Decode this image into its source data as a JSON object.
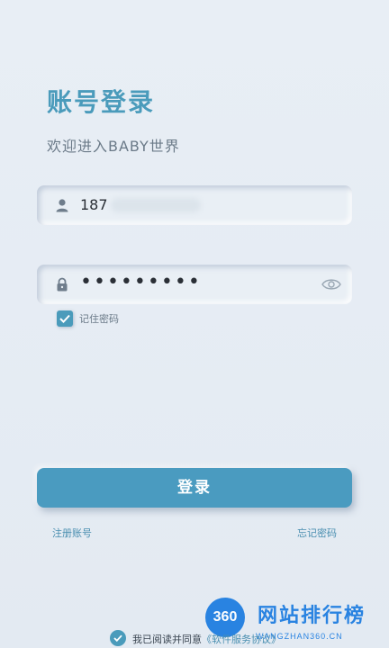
{
  "header": {
    "title": "账号登录",
    "subtitle": "欢迎进入BABY世界"
  },
  "username_field": {
    "icon": "user-icon",
    "value": "187"
  },
  "password_field": {
    "icon": "lock-icon",
    "masked_value": "•••••••••",
    "toggle_icon": "eye-icon"
  },
  "remember": {
    "checked": true,
    "label": "记住密码"
  },
  "login_button": {
    "label": "登录"
  },
  "links": {
    "register": "注册账号",
    "forgot": "忘记密码"
  },
  "agreement": {
    "checked": true,
    "prefix": "我已阅读并同意",
    "link_text": "《软件服务协议》"
  },
  "watermark": {
    "badge": "360",
    "title": "网站排行榜",
    "subtitle": "WANGZHAN360.CN"
  },
  "colors": {
    "accent": "#4a9bbb",
    "button": "#4a9bc0",
    "background": "#e6edf4",
    "watermark": "#1a7be0"
  }
}
